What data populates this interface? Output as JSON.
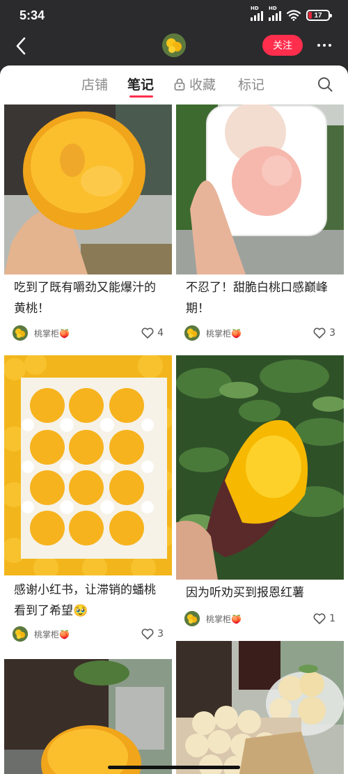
{
  "status_bar": {
    "time": "5:34",
    "network_1": "HD",
    "network_2": "HD",
    "battery": "17",
    "battery_level": 0.17,
    "battery_color": "#e2283c"
  },
  "header": {
    "back_icon": "chevron-left-icon",
    "follow_label": "关注",
    "more_icon": "more-dots-icon",
    "accent": "#ff2e4d"
  },
  "tabs": {
    "items": [
      {
        "label": "店铺"
      },
      {
        "label": "笔记"
      },
      {
        "label": "收藏"
      },
      {
        "label": "标记"
      }
    ],
    "active": "笔记",
    "search_icon": "search-icon"
  },
  "notes": [
    {
      "title": "吃到了既有嚼劲又能爆汁的黄桃！",
      "author": "桃掌柜🍑",
      "likes": "4"
    },
    {
      "title": "不忍了！甜脆白桃口感巅峰期！",
      "author": "桃掌柜🍑",
      "likes": "3"
    },
    {
      "title": "感谢小红书，让滞销的蟠桃看到了希望🥹",
      "author": "桃掌柜🍑",
      "likes": "3"
    },
    {
      "title": "因为听劝买到报恩红薯",
      "author": "桃掌柜🍑",
      "likes": "1"
    },
    {
      "title": "",
      "author": "",
      "likes": ""
    },
    {
      "title": "",
      "author": "",
      "likes": ""
    }
  ]
}
